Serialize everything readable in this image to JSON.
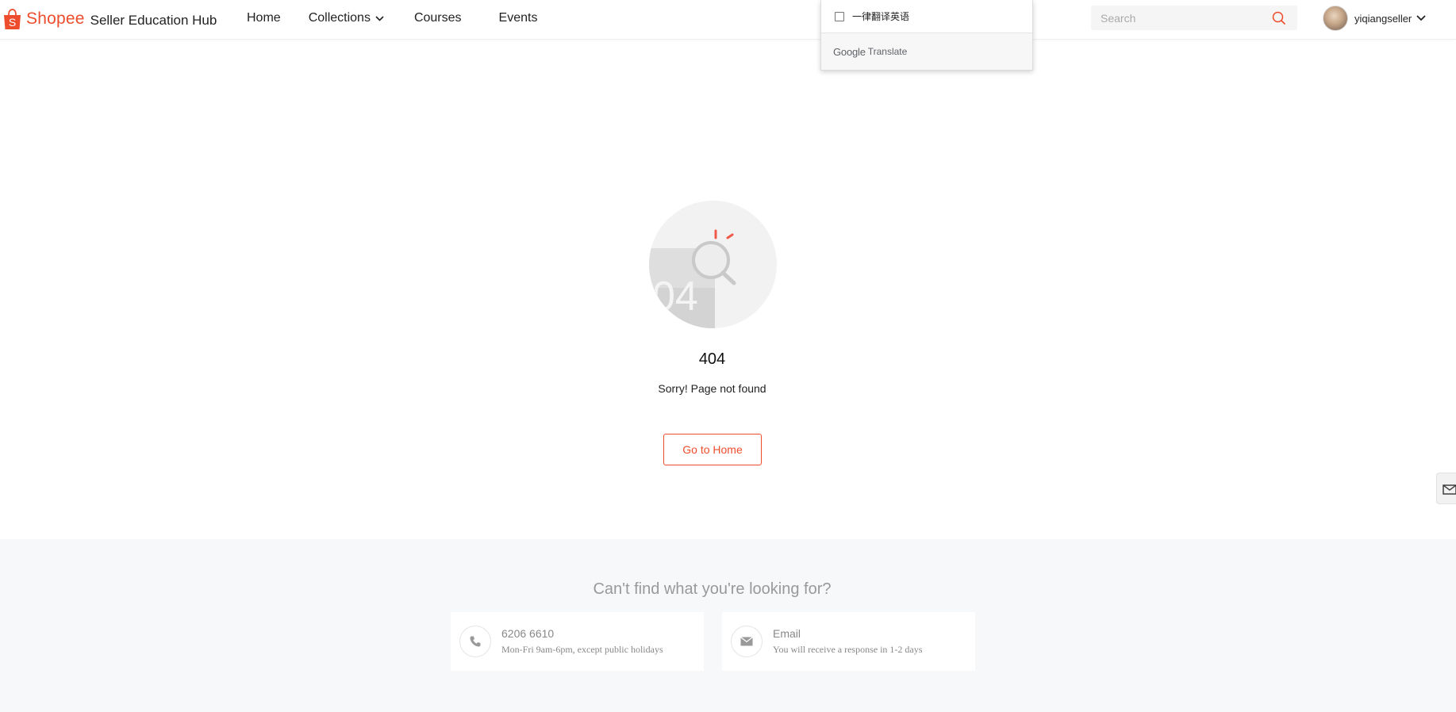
{
  "header": {
    "brand": "Shopee",
    "hub_title": "Seller Education Hub",
    "nav": [
      {
        "label": "Home"
      },
      {
        "label": "Collections"
      },
      {
        "label": "Courses"
      },
      {
        "label": "Events"
      }
    ],
    "search": {
      "placeholder": "Search",
      "value": ""
    },
    "user": {
      "name": "yiqiangseller"
    }
  },
  "translate_popup": {
    "checkbox_label": "一律翻译英语",
    "checked": false,
    "footer_google": "Google",
    "footer_translate": "Translate"
  },
  "error": {
    "illustration_text": "04",
    "code": "404",
    "message": "Sorry! Page not found",
    "button_label": "Go to Home"
  },
  "help": {
    "title": "Can't find what you're looking for?",
    "phone": {
      "number": "6206 6610",
      "hours": "Mon-Fri 9am-6pm, except public holidays"
    },
    "email": {
      "label": "Email",
      "note": "You will receive a response in 1-2 days"
    }
  },
  "colors": {
    "brand": "#ee4d2d",
    "muted_text": "#888888",
    "footer_bg": "#f7f8fa"
  },
  "icons": {
    "logo": "shopee-bag-icon",
    "collections_chevron": "chevron-down-icon",
    "search": "search-icon",
    "user_chevron": "chevron-down-icon",
    "side_tab": "feedback-mail-icon",
    "phone": "phone-icon",
    "email": "mail-icon"
  }
}
